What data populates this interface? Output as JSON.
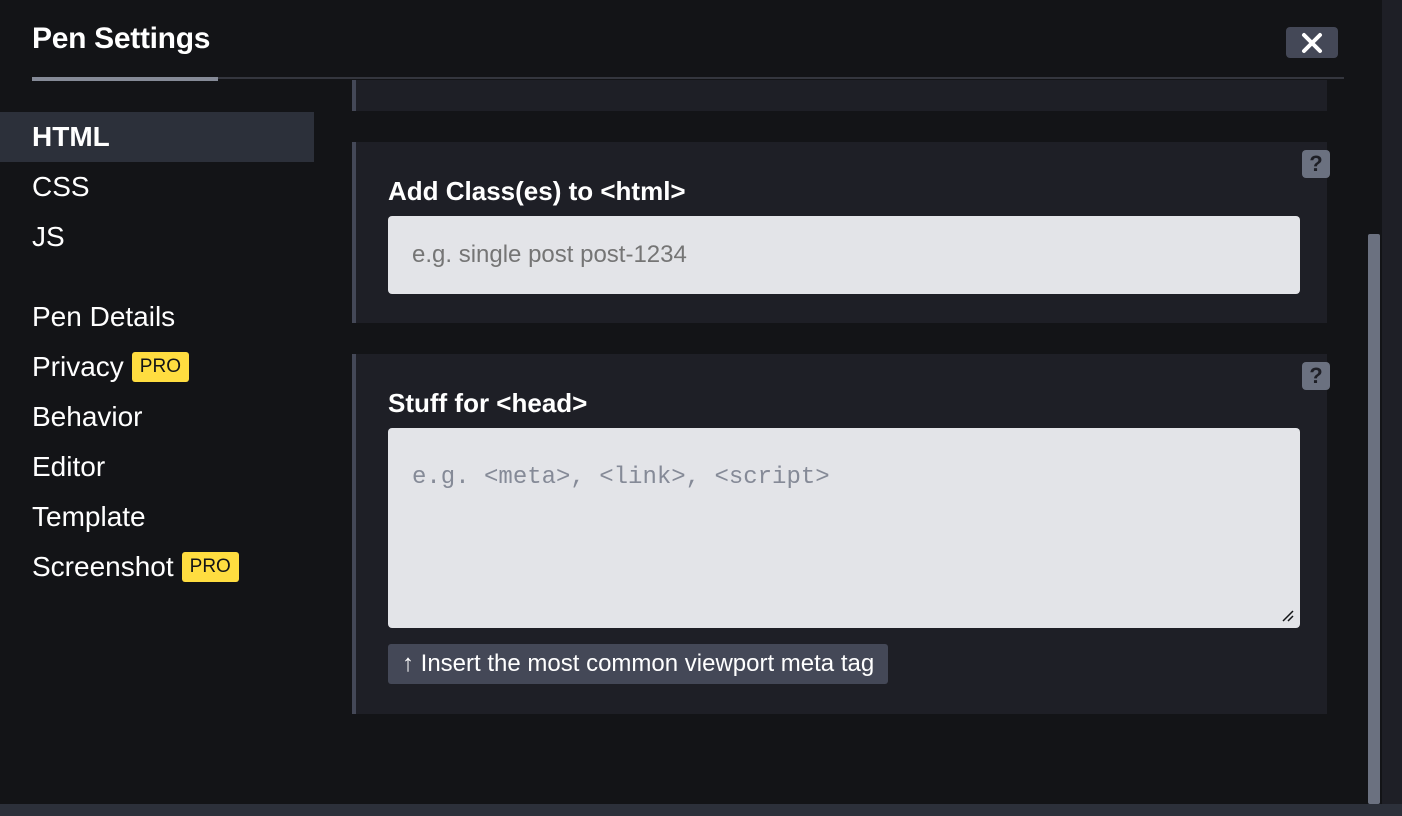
{
  "dialog": {
    "title": "Pen Settings",
    "close_icon": "close-x-icon"
  },
  "sidebar": {
    "primary": [
      {
        "label": "HTML",
        "active": true
      },
      {
        "label": "CSS",
        "active": false
      },
      {
        "label": "JS",
        "active": false
      }
    ],
    "secondary": [
      {
        "label": "Pen Details"
      },
      {
        "label": "Privacy",
        "badge": "PRO"
      },
      {
        "label": "Behavior"
      },
      {
        "label": "Editor"
      },
      {
        "label": "Template"
      },
      {
        "label": "Screenshot",
        "badge": "PRO"
      }
    ]
  },
  "html_classes": {
    "label": "Add Class(es) to <html>",
    "placeholder": "e.g. single post post-1234",
    "value": "",
    "help_icon": "question-mark-icon"
  },
  "head_stuff": {
    "label": "Stuff for <head>",
    "placeholder": "e.g. <meta>, <link>, <script>",
    "value": "",
    "help_icon": "question-mark-icon",
    "insert_button": "↑ Insert the most common viewport meta tag"
  },
  "colors": {
    "background": "#131417",
    "panel": "#1e1f26",
    "active_item": "#2c303a",
    "badge": "#ffdd40",
    "input": "#e3e4e8"
  }
}
